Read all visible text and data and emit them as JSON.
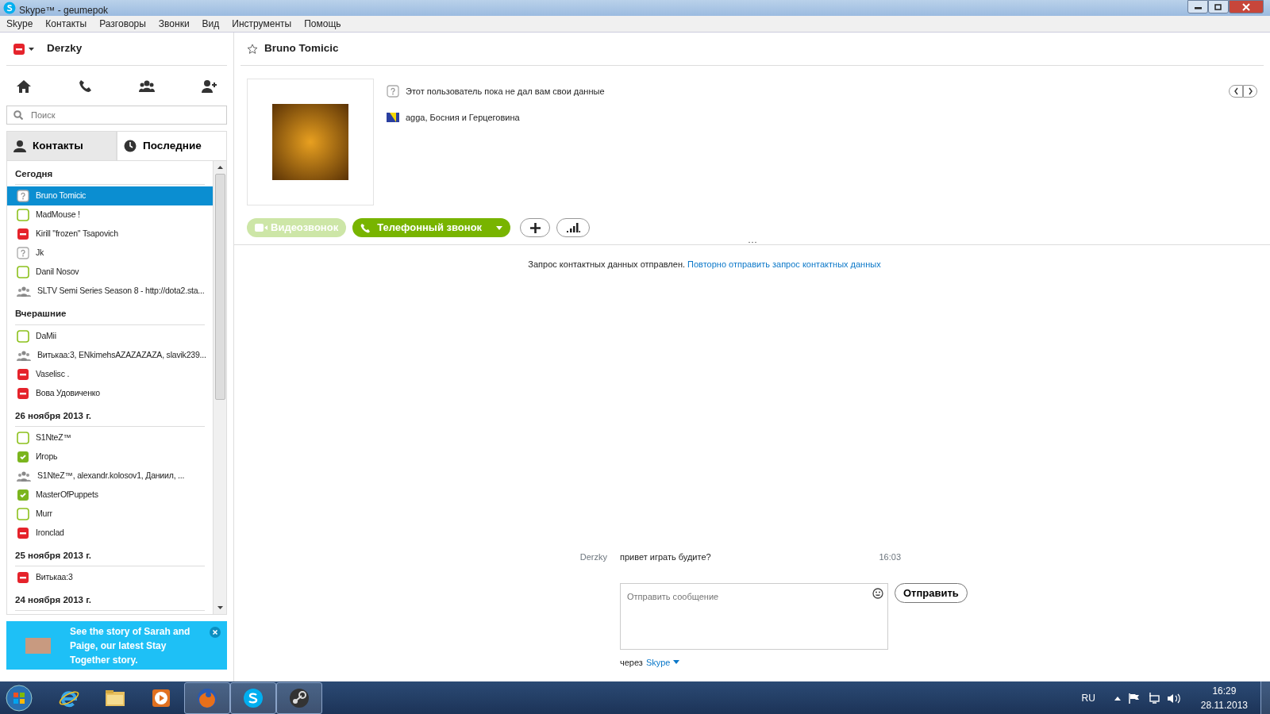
{
  "window": {
    "title": "Skype™ - geumepok"
  },
  "menu": [
    "Skype",
    "Контакты",
    "Разговоры",
    "Звонки",
    "Вид",
    "Инструменты",
    "Помощь"
  ],
  "user": {
    "name": "Derzky",
    "kind": "dnd"
  },
  "search": {
    "placeholder": "Поиск"
  },
  "tabs": [
    {
      "label": "Контакты",
      "kind": "person",
      "selected": false
    },
    {
      "label": "Последние",
      "kind": "clock",
      "selected": true
    }
  ],
  "groups": [
    {
      "heading": "Сегодня",
      "items": [
        {
          "name": "Bruno Tomicic",
          "kind": "unknown",
          "selected": true
        },
        {
          "name": "MadMouse !",
          "kind": "offline",
          "selected": false
        },
        {
          "name": "Kirill \"frozen\" Tsapovich",
          "kind": "dnd",
          "selected": false
        },
        {
          "name": "Jk",
          "kind": "unknown",
          "selected": false
        },
        {
          "name": "Danil Nosov",
          "kind": "offline",
          "selected": false
        },
        {
          "name": "SLTV Semi Series Season 8 - http://dota2.sta...",
          "kind": "group",
          "selected": false
        }
      ]
    },
    {
      "heading": "Вчерашние",
      "items": [
        {
          "name": "DaMii",
          "kind": "offline",
          "selected": false
        },
        {
          "name": "Витькаа:3, ENkimehsAZAZAZAZA, slavik239...",
          "kind": "group",
          "selected": false
        },
        {
          "name": "Vaselisc .",
          "kind": "dnd",
          "selected": false
        },
        {
          "name": "Вова Удовиченко",
          "kind": "dnd",
          "selected": false
        }
      ]
    },
    {
      "heading": "26 ноября 2013 г.",
      "items": [
        {
          "name": "S1NteZ™",
          "kind": "offline",
          "selected": false
        },
        {
          "name": "Игорь",
          "kind": "online",
          "selected": false
        },
        {
          "name": "S1NteZ™, alexandr.kolosov1, Даниил, ...",
          "kind": "group",
          "selected": false
        },
        {
          "name": "MasterOfPuppets",
          "kind": "online",
          "selected": false
        },
        {
          "name": "Murr",
          "kind": "offline",
          "selected": false
        },
        {
          "name": "Ironclad",
          "kind": "dnd",
          "selected": false
        }
      ]
    },
    {
      "heading": "25 ноября 2013 г.",
      "items": [
        {
          "name": "Витькаа:3",
          "kind": "dnd",
          "selected": false
        }
      ]
    },
    {
      "heading": "24 ноября 2013 г."
    }
  ],
  "promo": {
    "text": "See the story of Sarah and Paige, our latest Stay Together story."
  },
  "contact": {
    "name": "Bruno Tomicic",
    "info": [
      {
        "text": "Этот пользователь пока не дал вам свои данные",
        "kind": "unknown"
      },
      {
        "text": "agga, Босния и Герцеговина",
        "kind": "flag"
      }
    ]
  },
  "actions": {
    "video": {
      "label": "Видеозвонок",
      "disabled": true
    },
    "call": {
      "label": "Телефонный звонок",
      "disabled": false
    }
  },
  "notice": {
    "text": "Запрос контактных данных отправлен.",
    "link": "Повторно отправить запрос контактных данных"
  },
  "messages": [
    {
      "author": "Derzky",
      "text": "привет играть будите?",
      "time": "16:03"
    }
  ],
  "compose": {
    "placeholder": "Отправить сообщение",
    "send": "Отправить",
    "via": "через",
    "via_link": "Skype"
  },
  "taskbar": {
    "apps": [
      {
        "kind": "browser",
        "active": false
      },
      {
        "kind": "folder",
        "active": false
      },
      {
        "kind": "media",
        "active": false
      },
      {
        "kind": "firefox",
        "active": true
      },
      {
        "kind": "skype",
        "active": true
      },
      {
        "kind": "steam",
        "active": true
      }
    ],
    "lang": "RU",
    "time": "16:29",
    "date": "28.11.2013"
  }
}
